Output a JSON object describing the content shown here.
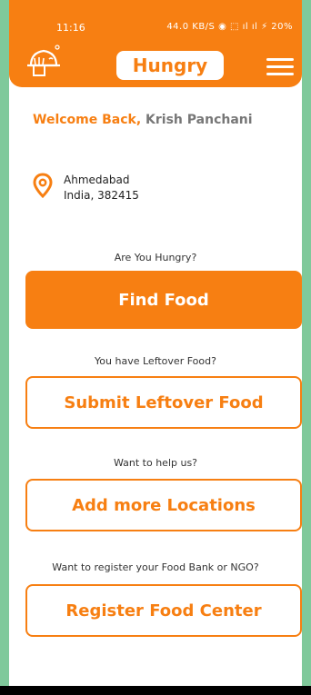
{
  "status_bar": {
    "time": "11:16",
    "icons": "44.0 KB/S ◉ ⬚ ıl ıl ⚡ 20%"
  },
  "header": {
    "title": "Hungry"
  },
  "welcome": {
    "prefix": "Welcome Back,",
    "name": " Krish Panchani"
  },
  "location": {
    "city": "Ahmedabad",
    "country_pin": "India, 382415"
  },
  "sections": {
    "hungry_prompt": "Are You Hungry?",
    "find_food": "Find Food",
    "leftover_prompt": "You have Leftover Food?",
    "submit_leftover": "Submit Leftover Food",
    "help_prompt": "Want to help us?",
    "add_locations": "Add more Locations",
    "register_prompt": "Want to register your Food Bank or NGO?",
    "register_center": "Register Food Center"
  },
  "colors": {
    "accent": "#f77f12",
    "frame_bg": "#7fc99b"
  },
  "icons": {
    "logo": "food-bowl-logo-icon",
    "menu": "hamburger-menu-icon",
    "location": "location-pin-icon"
  }
}
